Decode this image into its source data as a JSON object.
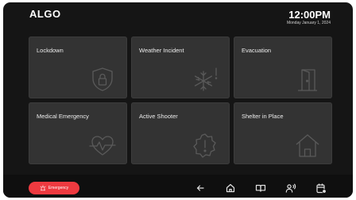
{
  "header": {
    "brand": "ALGO",
    "time": "12:00PM",
    "date": "Monday January 1, 2024"
  },
  "tiles": [
    {
      "label": "Lockdown",
      "icon": "shield-lock-icon"
    },
    {
      "label": "Weather Incident",
      "icon": "snowflake-alert-icon"
    },
    {
      "label": "Evacuation",
      "icon": "exit-door-icon"
    },
    {
      "label": "Medical Emergency",
      "icon": "heart-pulse-icon"
    },
    {
      "label": "Active Shooter",
      "icon": "alert-badge-icon"
    },
    {
      "label": "Shelter in Place",
      "icon": "house-icon"
    }
  ],
  "bottom_bar": {
    "emergency_label": "Emergency",
    "emergency_icon": "siren-icon",
    "nav_icons": [
      "back-arrow-icon",
      "home-icon",
      "book-icon",
      "user-voice-icon",
      "calendar-settings-icon"
    ]
  },
  "colors": {
    "background": "#151515",
    "tile": "#333333",
    "icon_outline": "#5a5a5a",
    "accent": "#ee3a40"
  }
}
